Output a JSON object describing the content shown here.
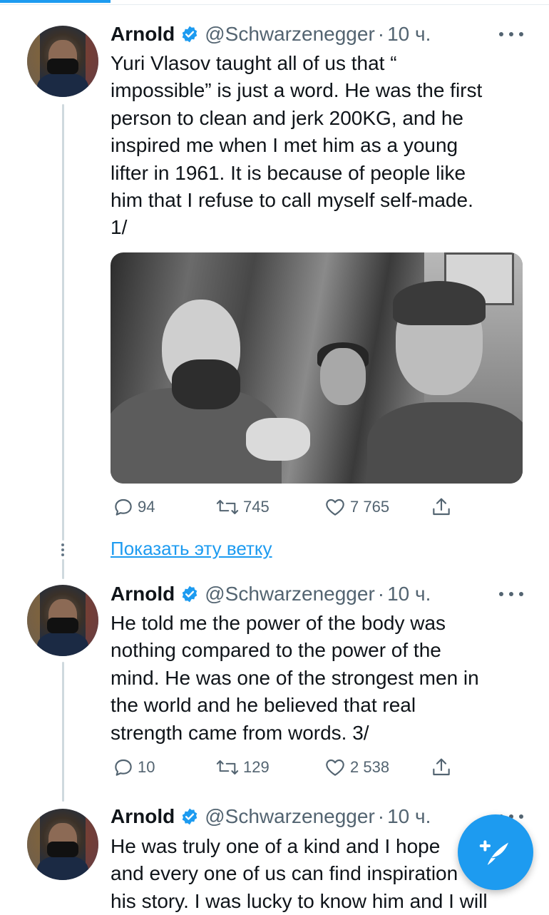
{
  "colors": {
    "accent": "#1d9bf0",
    "text": "#0f1419",
    "muted": "#536471",
    "thread_line": "#cfd9de"
  },
  "tweets": [
    {
      "name": "Arnold",
      "handle": "@Schwarzenegger",
      "dot": "·",
      "time": "10 ч.",
      "text": "Yuri Vlasov taught all of us that “\nimpossible” is just a word. He was the first\nperson to clean and jerk 200KG, and he\ninspired me when I met him as a young\nlifter in 1961. It is because of people like\nhim that I refuse to call myself self-made.\n1/",
      "has_image": true,
      "replies": "94",
      "retweets": "745",
      "likes": "7 765"
    },
    {
      "name": "Arnold",
      "handle": "@Schwarzenegger",
      "dot": "·",
      "time": "10 ч.",
      "text": "He told me the power of the body was\nnothing compared to the power of the\nmind. He was one of the strongest men in\nthe world and he believed that real\nstrength came from words. 3/",
      "has_image": false,
      "replies": "10",
      "retweets": "129",
      "likes": "2 538"
    },
    {
      "name": "Arnold",
      "handle": "@Schwarzenegger",
      "dot": "·",
      "time": "10 ч.",
      "text": "He was truly one of a kind and I hope\nand every one of us can find inspiration\nhis story. I was lucky to know him and I will"
    }
  ],
  "show_thread_label": "Показать эту ветку",
  "icons": {
    "verified": "verified-badge-icon",
    "more": "more-dots-icon",
    "reply": "reply-bubble-icon",
    "retweet": "retweet-arrows-icon",
    "like": "heart-icon",
    "share": "share-upload-icon",
    "compose": "compose-feather-icon"
  }
}
